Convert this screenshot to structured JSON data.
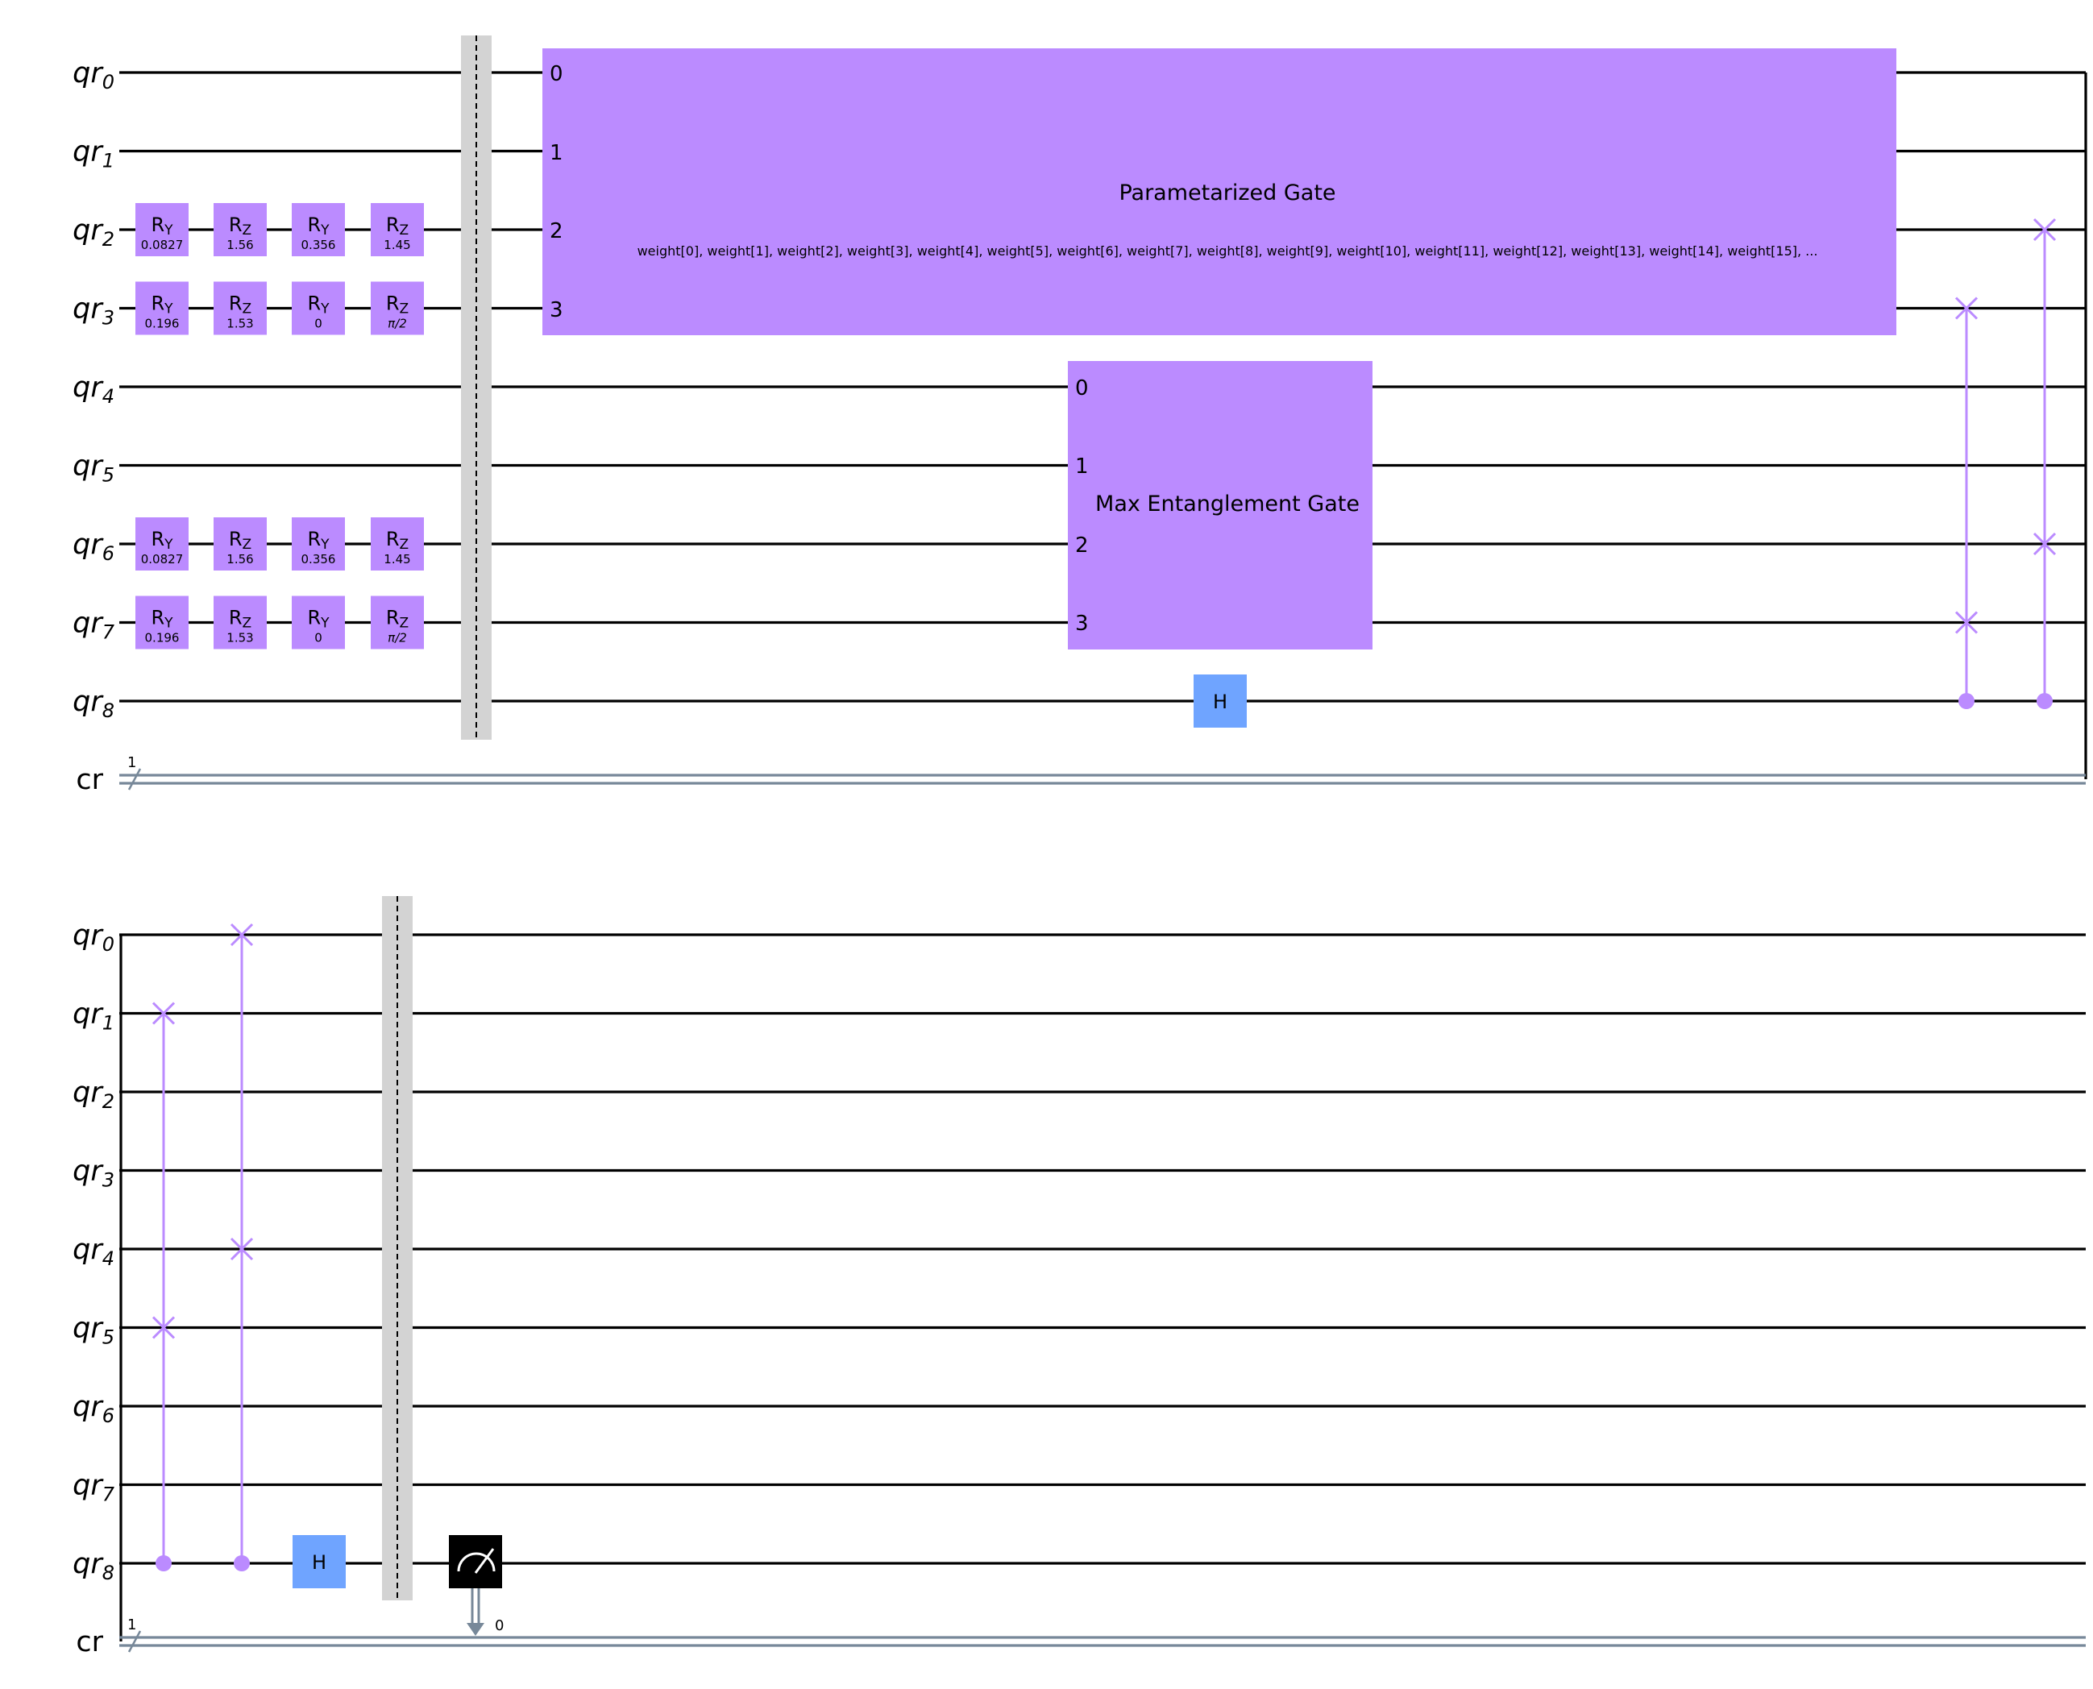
{
  "qubits": [
    {
      "base": "qr",
      "sub": "0"
    },
    {
      "base": "qr",
      "sub": "1"
    },
    {
      "base": "qr",
      "sub": "2"
    },
    {
      "base": "qr",
      "sub": "3"
    },
    {
      "base": "qr",
      "sub": "4"
    },
    {
      "base": "qr",
      "sub": "5"
    },
    {
      "base": "qr",
      "sub": "6"
    },
    {
      "base": "qr",
      "sub": "7"
    },
    {
      "base": "qr",
      "sub": "8"
    }
  ],
  "classical": {
    "label": "cr",
    "bits": "1"
  },
  "rotation_gates": [
    {
      "qubit": 2,
      "column": 0,
      "base": "R",
      "sub": "Y",
      "param": "0.0827"
    },
    {
      "qubit": 2,
      "column": 1,
      "base": "R",
      "sub": "Z",
      "param": "1.56"
    },
    {
      "qubit": 2,
      "column": 2,
      "base": "R",
      "sub": "Y",
      "param": "0.356"
    },
    {
      "qubit": 2,
      "column": 3,
      "base": "R",
      "sub": "Z",
      "param": "1.45"
    },
    {
      "qubit": 3,
      "column": 0,
      "base": "R",
      "sub": "Y",
      "param": "0.196"
    },
    {
      "qubit": 3,
      "column": 1,
      "base": "R",
      "sub": "Z",
      "param": "1.53"
    },
    {
      "qubit": 3,
      "column": 2,
      "base": "R",
      "sub": "Y",
      "param": "0"
    },
    {
      "qubit": 3,
      "column": 3,
      "base": "R",
      "sub": "Z",
      "param": "π/2"
    },
    {
      "qubit": 6,
      "column": 0,
      "base": "R",
      "sub": "Y",
      "param": "0.0827"
    },
    {
      "qubit": 6,
      "column": 1,
      "base": "R",
      "sub": "Z",
      "param": "1.56"
    },
    {
      "qubit": 6,
      "column": 2,
      "base": "R",
      "sub": "Y",
      "param": "0.356"
    },
    {
      "qubit": 6,
      "column": 3,
      "base": "R",
      "sub": "Z",
      "param": "1.45"
    },
    {
      "qubit": 7,
      "column": 0,
      "base": "R",
      "sub": "Y",
      "param": "0.196"
    },
    {
      "qubit": 7,
      "column": 1,
      "base": "R",
      "sub": "Z",
      "param": "1.53"
    },
    {
      "qubit": 7,
      "column": 2,
      "base": "R",
      "sub": "Y",
      "param": "0"
    },
    {
      "qubit": 7,
      "column": 3,
      "base": "R",
      "sub": "Z",
      "param": "π/2"
    }
  ],
  "param_gate": {
    "name": "Parametarized Gate",
    "qubits": [
      0,
      1,
      2,
      3
    ],
    "ports": [
      "0",
      "1",
      "2",
      "3"
    ],
    "params": "weight[0], weight[1], weight[2], weight[3], weight[4], weight[5], weight[6], weight[7], weight[8], weight[9], weight[10], weight[11], weight[12], weight[13], weight[14], weight[15], ..."
  },
  "ent_gate": {
    "name": "Max Entanglement Gate",
    "qubits": [
      4,
      5,
      6,
      7
    ],
    "ports": [
      "0",
      "1",
      "2",
      "3"
    ]
  },
  "h_gate_label": "H",
  "cswaps_top": [
    {
      "control": 8,
      "targets": [
        3,
        7
      ]
    },
    {
      "control": 8,
      "targets": [
        2,
        6
      ]
    }
  ],
  "cswaps_bottom": [
    {
      "control": 8,
      "targets": [
        1,
        5
      ]
    },
    {
      "control": 8,
      "targets": [
        0,
        4
      ]
    }
  ],
  "measure": {
    "qubit": 8,
    "bit_index": "0"
  },
  "colors": {
    "gate_purple": "#bb8bff",
    "hadamard_blue": "#6fa4ff",
    "barrier_gray": "#d3d3d3",
    "classical_wire": "#778899",
    "measure_black": "#000000"
  }
}
